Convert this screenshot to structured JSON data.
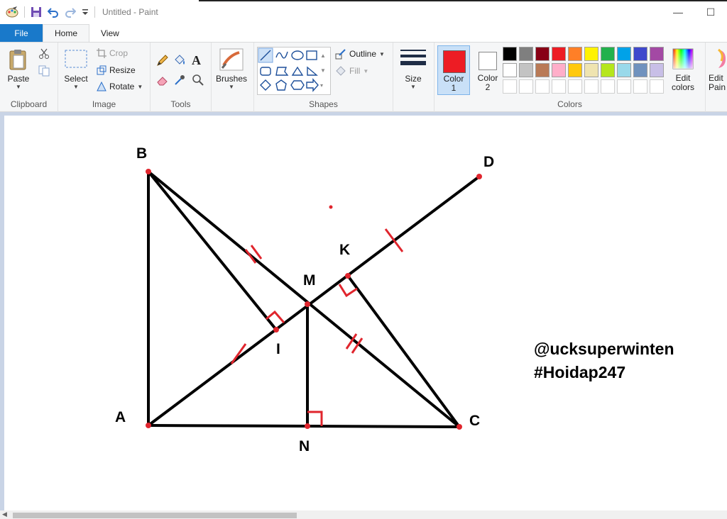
{
  "window": {
    "title": "Untitled - Paint",
    "minimize_glyph": "—",
    "maximize_glyph": "☐"
  },
  "tabs": [
    {
      "label": "File"
    },
    {
      "label": "Home"
    },
    {
      "label": "View"
    }
  ],
  "ribbon": {
    "clipboard": {
      "label": "Clipboard",
      "paste": "Paste"
    },
    "image": {
      "label": "Image",
      "select": "Select",
      "crop": "Crop",
      "resize": "Resize",
      "rotate": "Rotate"
    },
    "tools": {
      "label": "Tools"
    },
    "brushes": {
      "label": "Brushes"
    },
    "shapes": {
      "label": "Shapes",
      "outline": "Outline",
      "fill": "Fill"
    },
    "size": {
      "label": "Size"
    },
    "colors": {
      "label": "Colors",
      "color1": "Color",
      "color1_num": "1",
      "color2": "Color",
      "color2_num": "2",
      "edit_colors_1": "Edit",
      "edit_colors_2": "colors",
      "edit_paint_1": "Edit",
      "edit_paint_2": "Pain",
      "color1_value": "#ed1c24",
      "color2_value": "#ffffff",
      "palette_row1": [
        "#000000",
        "#7f7f7f",
        "#880015",
        "#ed1c24",
        "#ff7f27",
        "#fff200",
        "#22b14c",
        "#00a2e8",
        "#3f48cc",
        "#a349a4"
      ],
      "palette_row2": [
        "#ffffff",
        "#c3c3c3",
        "#b97a57",
        "#ffaec9",
        "#ffc90e",
        "#efe4b0",
        "#b5e61d",
        "#99d9ea",
        "#7092be",
        "#c8bfe7"
      ]
    }
  },
  "drawing": {
    "labels": {
      "A": "A",
      "B": "B",
      "C": "C",
      "D": "D",
      "M": "M",
      "K": "K",
      "I": "I",
      "N": "N"
    },
    "watermark_line1": "@ucksuperwinten",
    "watermark_line2": "#Hoidap247"
  }
}
